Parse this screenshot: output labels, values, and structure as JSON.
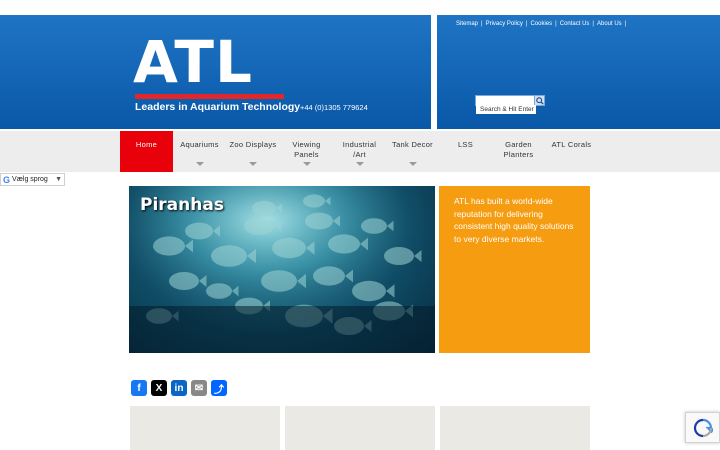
{
  "header": {
    "logo_text": "ATL",
    "tagline": "Leaders in Aquarium Technology",
    "phone": "+44 (0)1305 779624",
    "top_links": [
      "Sitemap",
      "Privacy Policy",
      "Cookies",
      "Contact Us",
      "About Us"
    ],
    "search_placeholder": "Search & Hit Enter",
    "colors": {
      "header_blue": "#1f74c4",
      "logo_bar": "#e4262a"
    }
  },
  "nav": {
    "items": [
      {
        "label": "Home",
        "active": true,
        "has_dropdown": false
      },
      {
        "label": "Aquariums",
        "active": false,
        "has_dropdown": true
      },
      {
        "label": "Zoo Displays",
        "active": false,
        "has_dropdown": true
      },
      {
        "label": "Viewing\nPanels",
        "active": false,
        "has_dropdown": true
      },
      {
        "label": "Industrial\n/Art",
        "active": false,
        "has_dropdown": true
      },
      {
        "label": "Tank Decor",
        "active": false,
        "has_dropdown": true
      },
      {
        "label": "LSS",
        "active": false,
        "has_dropdown": false
      },
      {
        "label": "Garden\nPlanters",
        "active": false,
        "has_dropdown": false
      },
      {
        "label": "ATL Corals",
        "active": false,
        "has_dropdown": false
      }
    ],
    "active_color": "#e8000b"
  },
  "language": {
    "label": "Vælg sprog",
    "icon": "google-g-icon"
  },
  "hero": {
    "title": "Piranhas",
    "image": "piranha-school-photo"
  },
  "intro": {
    "text": "ATL has built a world-wide reputation for delivering consistent high quality solutions to very diverse markets.",
    "color": "#f59c10"
  },
  "share": {
    "buttons": [
      {
        "name": "facebook-icon",
        "glyph": "f",
        "color": "#1877f2"
      },
      {
        "name": "x-icon",
        "glyph": "X",
        "color": "#000000"
      },
      {
        "name": "linkedin-icon",
        "glyph": "in",
        "color": "#0a66c2"
      },
      {
        "name": "email-icon",
        "glyph": "✉",
        "color": "#888888"
      },
      {
        "name": "share-icon",
        "glyph": "⤴",
        "color": "#0166ff"
      }
    ]
  },
  "recaptcha": {
    "icon": "recaptcha-icon"
  }
}
